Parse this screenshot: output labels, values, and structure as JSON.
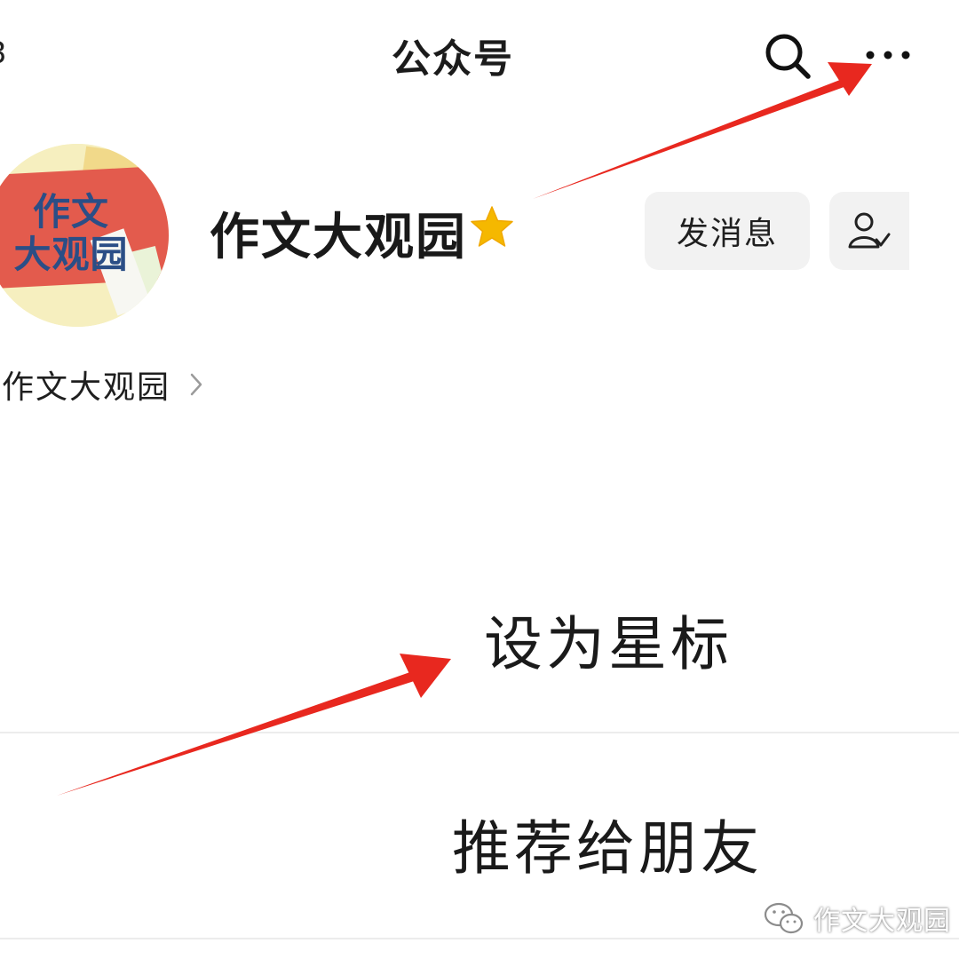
{
  "status_bar": {
    "fragment": "3"
  },
  "nav": {
    "title": "公众号",
    "search_icon": "search-icon",
    "more_icon": "more-icon"
  },
  "profile": {
    "avatar_line1": "作文",
    "avatar_line2": "大观园",
    "name": "作文大观园",
    "star_icon": "star-icon",
    "send_message_label": "发消息",
    "follow_icon": "followed-user-icon"
  },
  "subject": {
    "label": "作文大观园"
  },
  "menu": {
    "items": [
      {
        "label": "设为星标"
      },
      {
        "label": "推荐给朋友"
      }
    ]
  },
  "watermark": {
    "label": "作文大观园",
    "icon": "wechat-icon"
  },
  "colors": {
    "arrow": "#e8281f",
    "star": "#f5b800",
    "button_bg": "#f2f2f2",
    "avatar_red": "#e35b4d"
  }
}
